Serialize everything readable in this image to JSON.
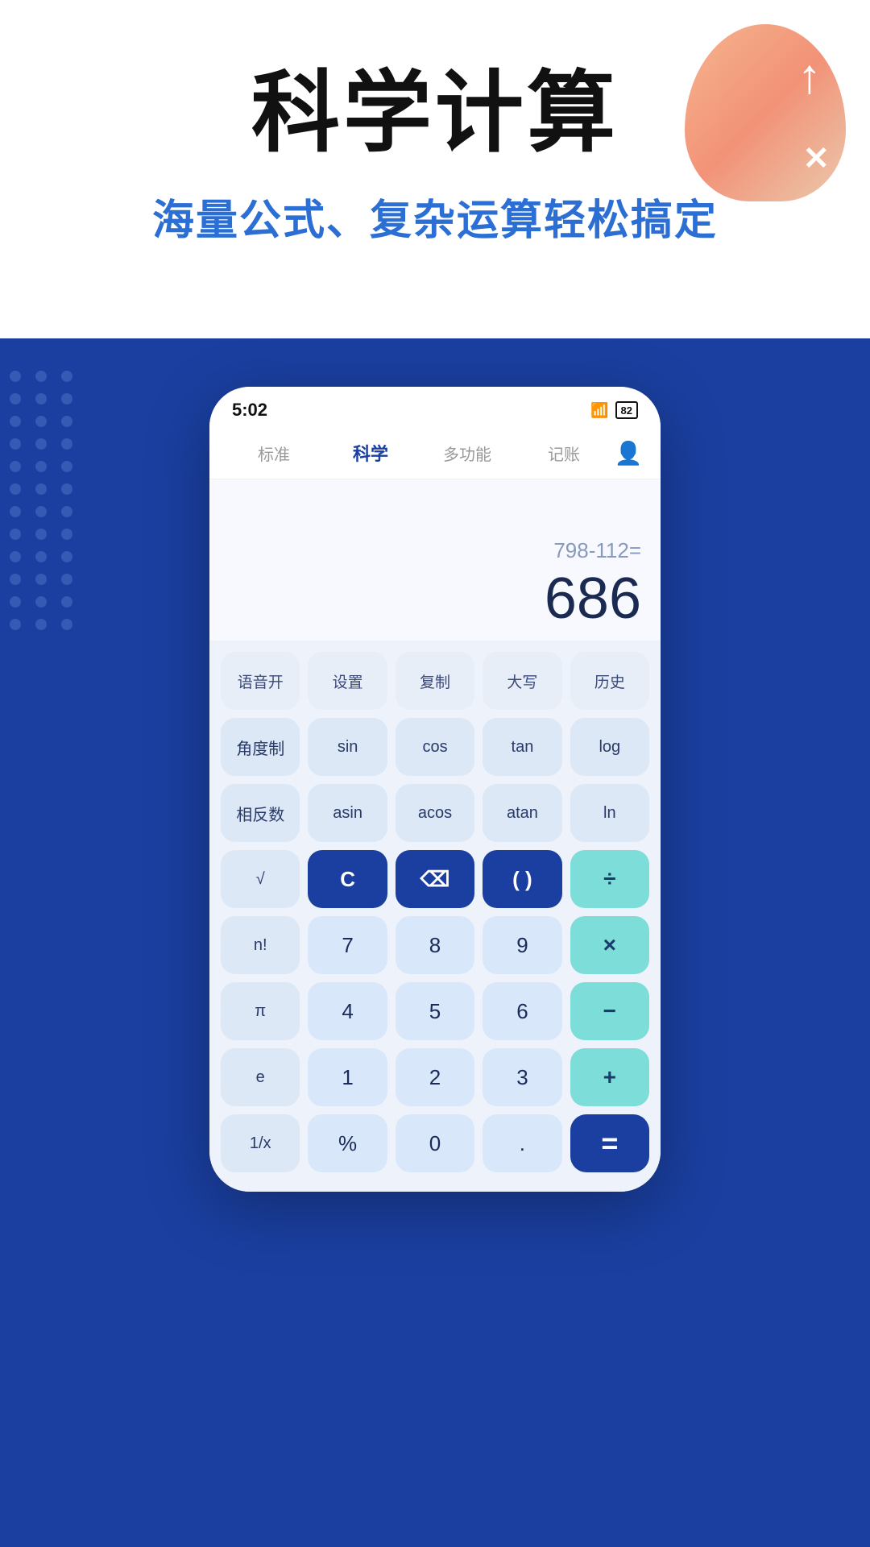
{
  "header": {
    "main_title": "科学计算",
    "sub_title": "海量公式、复杂运算轻松搞定"
  },
  "status_bar": {
    "time": "5:02",
    "battery": "82"
  },
  "tabs": [
    {
      "id": "standard",
      "label": "标准",
      "active": false
    },
    {
      "id": "science",
      "label": "科学",
      "active": true
    },
    {
      "id": "multi",
      "label": "多功能",
      "active": false
    },
    {
      "id": "bookkeep",
      "label": "记账",
      "active": false
    }
  ],
  "display": {
    "expression": "798-112=",
    "result": "686"
  },
  "keypad": {
    "rows": [
      [
        {
          "label": "语音开",
          "type": "utility"
        },
        {
          "label": "设置",
          "type": "utility"
        },
        {
          "label": "复制",
          "type": "utility"
        },
        {
          "label": "大写",
          "type": "utility"
        },
        {
          "label": "历史",
          "type": "utility"
        }
      ],
      [
        {
          "label": "角度制",
          "type": "sci"
        },
        {
          "label": "sin",
          "type": "sci"
        },
        {
          "label": "cos",
          "type": "sci"
        },
        {
          "label": "tan",
          "type": "sci"
        },
        {
          "label": "log",
          "type": "sci"
        }
      ],
      [
        {
          "label": "相反数",
          "type": "sci"
        },
        {
          "label": "asin",
          "type": "sci"
        },
        {
          "label": "acos",
          "type": "sci"
        },
        {
          "label": "atan",
          "type": "sci"
        },
        {
          "label": "ln",
          "type": "sci"
        }
      ],
      [
        {
          "label": "√",
          "type": "sci"
        },
        {
          "label": "C",
          "type": "dark-blue"
        },
        {
          "label": "⌫",
          "type": "dark-blue"
        },
        {
          "label": "( )",
          "type": "dark-blue"
        },
        {
          "label": "÷",
          "type": "teal"
        }
      ],
      [
        {
          "label": "n!",
          "type": "sci"
        },
        {
          "label": "7",
          "type": "num"
        },
        {
          "label": "8",
          "type": "num"
        },
        {
          "label": "9",
          "type": "num"
        },
        {
          "label": "×",
          "type": "teal"
        }
      ],
      [
        {
          "label": "π",
          "type": "sci"
        },
        {
          "label": "4",
          "type": "num"
        },
        {
          "label": "5",
          "type": "num"
        },
        {
          "label": "6",
          "type": "num"
        },
        {
          "label": "−",
          "type": "teal"
        }
      ],
      [
        {
          "label": "e",
          "type": "sci"
        },
        {
          "label": "1",
          "type": "num"
        },
        {
          "label": "2",
          "type": "num"
        },
        {
          "label": "3",
          "type": "num"
        },
        {
          "label": "+",
          "type": "teal"
        }
      ],
      [
        {
          "label": "1/x",
          "type": "sci"
        },
        {
          "label": "%",
          "type": "num"
        },
        {
          "label": "0",
          "type": "num"
        },
        {
          "label": ".",
          "type": "num"
        },
        {
          "label": "=",
          "type": "equal"
        }
      ]
    ]
  }
}
